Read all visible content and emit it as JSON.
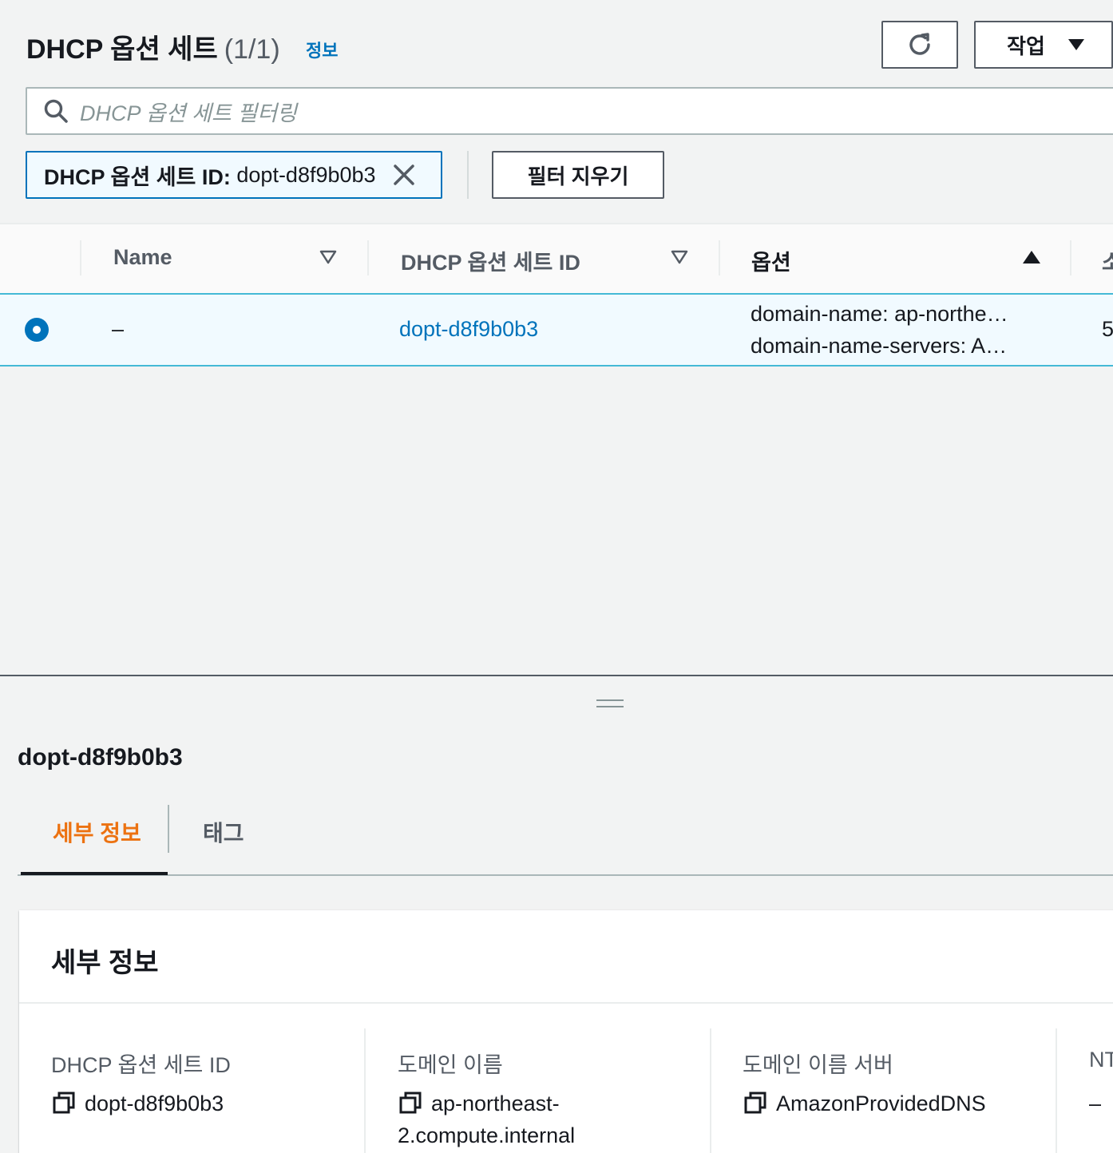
{
  "header": {
    "title": "DHCP 옵션 세트",
    "count": "(1/1)",
    "info_link": "정보",
    "actions_button": "작업"
  },
  "search": {
    "placeholder": "DHCP 옵션 세트 필터링"
  },
  "filter_token": {
    "key": "DHCP 옵션 세트 ID:",
    "value": "dopt-d8f9b0b3"
  },
  "clear_filters_button": "필터 지우기",
  "table": {
    "columns": [
      "Name",
      "DHCP 옵션 세트 ID",
      "옵션",
      "소"
    ],
    "rows": [
      {
        "name": "–",
        "id": "dopt-d8f9b0b3",
        "options_line1": "domain-name: ap-northe…",
        "options_line2": "domain-name-servers: A…",
        "owner_partial": "5"
      }
    ]
  },
  "panel": {
    "title": "dopt-d8f9b0b3",
    "tabs": [
      "세부 정보",
      "태그"
    ],
    "active_tab": "세부 정보",
    "card_title": "세부 정보",
    "details": [
      {
        "label": "DHCP 옵션 세트 ID",
        "value": "dopt-d8f9b0b3"
      },
      {
        "label": "도메인 이름",
        "value_line1": "ap-northeast-",
        "value_line2": "2.compute.internal"
      },
      {
        "label": "도메인 이름 서버",
        "value": "AmazonProvidedDNS"
      },
      {
        "label": "NT",
        "value": "–"
      }
    ]
  },
  "colors": {
    "link": "#0073bb",
    "active_tab": "#ec7211",
    "selected_row_bg": "#f1faff",
    "selected_row_border": "#44b9d6"
  }
}
